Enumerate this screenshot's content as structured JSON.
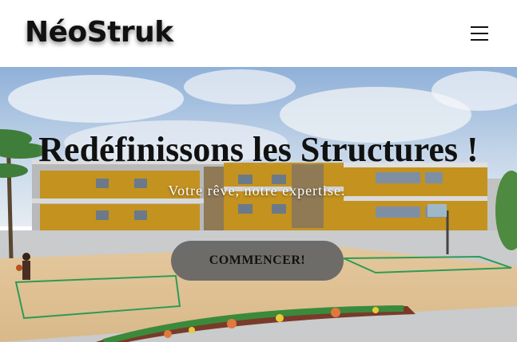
{
  "header": {
    "brand": "NéoStruk",
    "menu_icon": "hamburger-menu-icon"
  },
  "hero": {
    "title": "Redéfinissons les Structures !",
    "subtitle": "Votre rêve, notre expertise.",
    "cta_label": "COMMENCER!",
    "background_image": "school-building-courtyard-render"
  },
  "colors": {
    "header_bg": "#ffffff",
    "brand_text": "#111111",
    "cta_bg": "#646464",
    "building_wall": "#c4921f",
    "court_floor": "#e8c99a"
  }
}
